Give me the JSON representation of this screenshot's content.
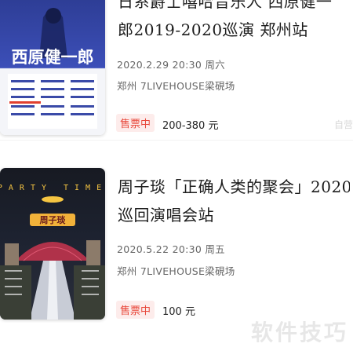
{
  "events": [
    {
      "title_lines": [
        "日系爵士嘻哈音乐人 西原健一",
        "郎2019-2020巡演 郑州站"
      ],
      "poster_text": "西原健一郎",
      "date": "2020.2.29 20:30 周六",
      "venue": "郑州 7LIVEHOUSE梁硯场",
      "status": "售票中",
      "price": "200-380 元",
      "side_tag": "自营"
    },
    {
      "title_lines": [
        "周子琰「正确人类的聚会」2020",
        "巡回演唱会站"
      ],
      "poster_text": "PARTY TIME",
      "poster_name": "周子琰",
      "date": "2020.5.22 20:30 周五",
      "venue": "郑州 7LIVEHOUSE梁硯场",
      "status": "售票中",
      "price": "100 元"
    }
  ],
  "watermark": "软件技巧"
}
